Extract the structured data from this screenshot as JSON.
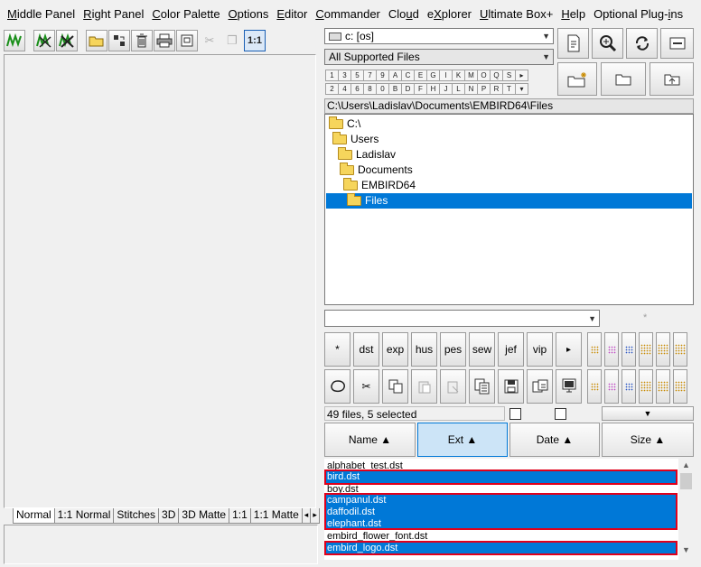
{
  "menu": [
    {
      "pre": "",
      "key": "M",
      "post": "iddle Panel"
    },
    {
      "pre": "",
      "key": "R",
      "post": "ight Panel"
    },
    {
      "pre": "",
      "key": "C",
      "post": "olor Palette"
    },
    {
      "pre": "",
      "key": "O",
      "post": "ptions"
    },
    {
      "pre": "",
      "key": "E",
      "post": "ditor"
    },
    {
      "pre": "",
      "key": "C",
      "post": "ommander"
    },
    {
      "pre": "Clo",
      "key": "u",
      "post": "d"
    },
    {
      "pre": "e",
      "key": "X",
      "post": "plorer"
    },
    {
      "pre": "",
      "key": "U",
      "post": "ltimate Box+"
    },
    {
      "pre": "",
      "key": "H",
      "post": "elp"
    },
    {
      "pre": "Optional Plug-",
      "key": "i",
      "post": "ns"
    }
  ],
  "left_toolbar": {
    "zoom_label": "1:1"
  },
  "view_tabs": [
    "Normal",
    "1:1 Normal",
    "Stitches",
    "3D",
    "3D Matte",
    "1:1",
    "1:1 Matte"
  ],
  "view_tabs_scroll": [
    "◂",
    "▸"
  ],
  "drive": {
    "value": "c: [os]"
  },
  "filter": {
    "value": "All Supported Files"
  },
  "letters_row1": [
    "1",
    "3",
    "5",
    "7",
    "9",
    "A",
    "C",
    "E",
    "G",
    "I",
    "K",
    "M",
    "O",
    "Q",
    "S",
    "▸"
  ],
  "letters_row2": [
    "2",
    "4",
    "6",
    "8",
    "0",
    "B",
    "D",
    "F",
    "H",
    "J",
    "L",
    "N",
    "P",
    "R",
    "T",
    "▾"
  ],
  "path": "C:\\Users\\Ladislav\\Documents\\EMBIRD64\\Files",
  "tree": [
    "C:\\",
    "Users",
    "Ladislav",
    "Documents",
    "EMBIRD64",
    "Files"
  ],
  "mask": {
    "value": "",
    "star": "*"
  },
  "ext_buttons": [
    "*",
    "dst",
    "exp",
    "hus",
    "pes",
    "sew",
    "jef",
    "vip",
    "▸"
  ],
  "status": {
    "count": "49 files, 5 selected"
  },
  "sort": {
    "name": "Name ▲",
    "ext": "Ext ▲",
    "date": "Date ▲",
    "size": "Size ▲"
  },
  "files": [
    {
      "name": "alphabet_test.dst",
      "sel": false
    },
    {
      "name": "bird.dst",
      "sel": true
    },
    {
      "name": "boy.dst",
      "sel": false
    },
    {
      "name": "campanul.dst",
      "sel": true
    },
    {
      "name": "daffodil.dst",
      "sel": true
    },
    {
      "name": "elephant.dst",
      "sel": true
    },
    {
      "name": "embird_flower_font.dst",
      "sel": false
    },
    {
      "name": "embird_logo.dst",
      "sel": true
    }
  ],
  "colors": {
    "accent": "#0078d7",
    "highlight": "#e0001b"
  }
}
